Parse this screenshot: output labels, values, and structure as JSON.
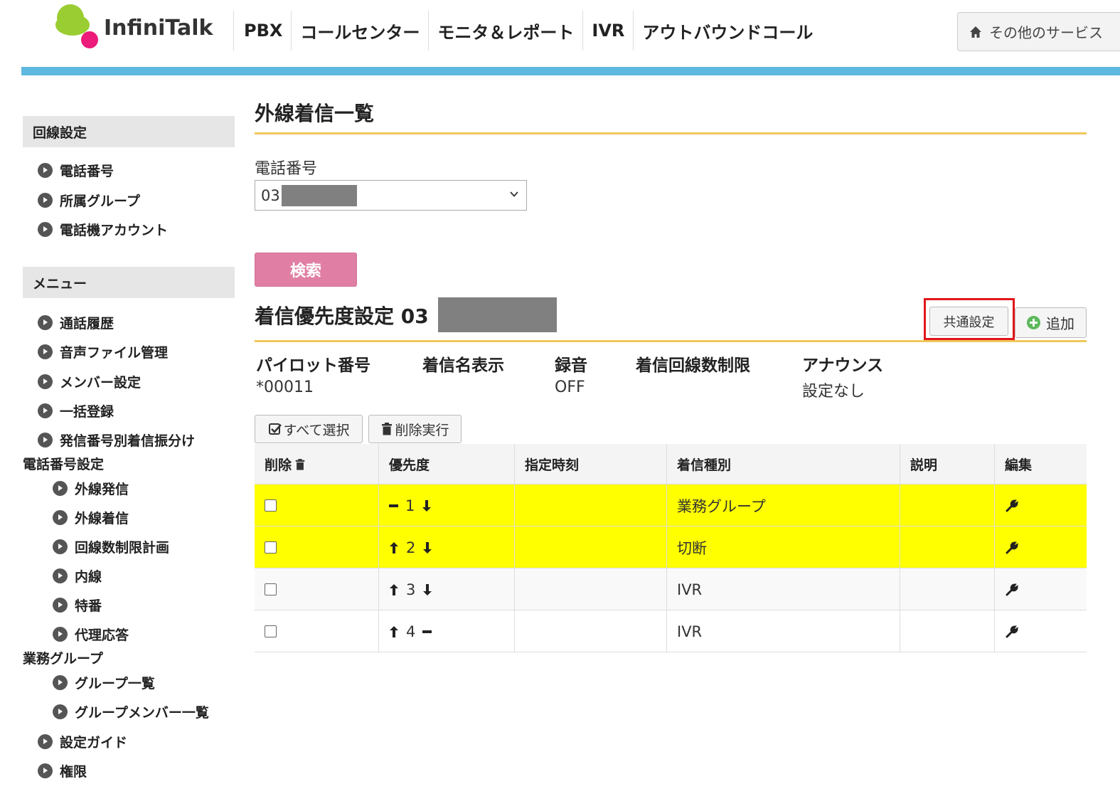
{
  "header": {
    "logo_text": "InfiniTalk",
    "nav": [
      "PBX",
      "コールセンター",
      "モニタ＆レポート",
      "IVR",
      "アウトバウンドコール"
    ],
    "other_services": "その他のサービス",
    "accent_color": "#5fb8de"
  },
  "sidebar": {
    "section1_title": "回線設定",
    "section1_items": [
      "電話番号",
      "所属グループ",
      "電話機アカウント"
    ],
    "section2_title": "メニュー",
    "section2_items": [
      "通話履歴",
      "音声ファイル管理",
      "メンバー設定",
      "一括登録",
      "発信番号別着信振分け"
    ],
    "phone_settings_title": "電話番号設定",
    "phone_settings_items": [
      "外線発信",
      "外線着信",
      "回線数制限計画",
      "内線",
      "特番",
      "代理応答"
    ],
    "group_title": "業務グループ",
    "group_items": [
      "グループ一覧",
      "グループメンバー一覧"
    ],
    "bottom_items": [
      "設定ガイド",
      "権限"
    ]
  },
  "main": {
    "page_title": "外線着信一覧",
    "phone_label": "電話番号",
    "phone_select_value": "03",
    "search_button": "検索",
    "section_title": "着信優先度設定 03",
    "common_settings_button": "共通設定",
    "add_button": "追加",
    "info": [
      {
        "header": "パイロット番号",
        "value": "*00011"
      },
      {
        "header": "着信名表示",
        "value": ""
      },
      {
        "header": "録音",
        "value": "OFF"
      },
      {
        "header": "着信回線数制限",
        "value": ""
      },
      {
        "header": "アナウンス",
        "value": "設定なし"
      }
    ],
    "select_all_button": "すべて選択",
    "delete_exec_button": "削除実行",
    "table": {
      "headers": [
        "削除",
        "優先度",
        "指定時刻",
        "着信種別",
        "説明",
        "編集"
      ],
      "rows": [
        {
          "priority": "1",
          "type": "業務グループ",
          "up": false,
          "down": true,
          "highlight": true
        },
        {
          "priority": "2",
          "type": "切断",
          "up": true,
          "down": true,
          "highlight": true
        },
        {
          "priority": "3",
          "type": "IVR",
          "up": true,
          "down": true,
          "highlight": false
        },
        {
          "priority": "4",
          "type": "IVR",
          "up": true,
          "down": false,
          "highlight": false
        }
      ]
    }
  }
}
